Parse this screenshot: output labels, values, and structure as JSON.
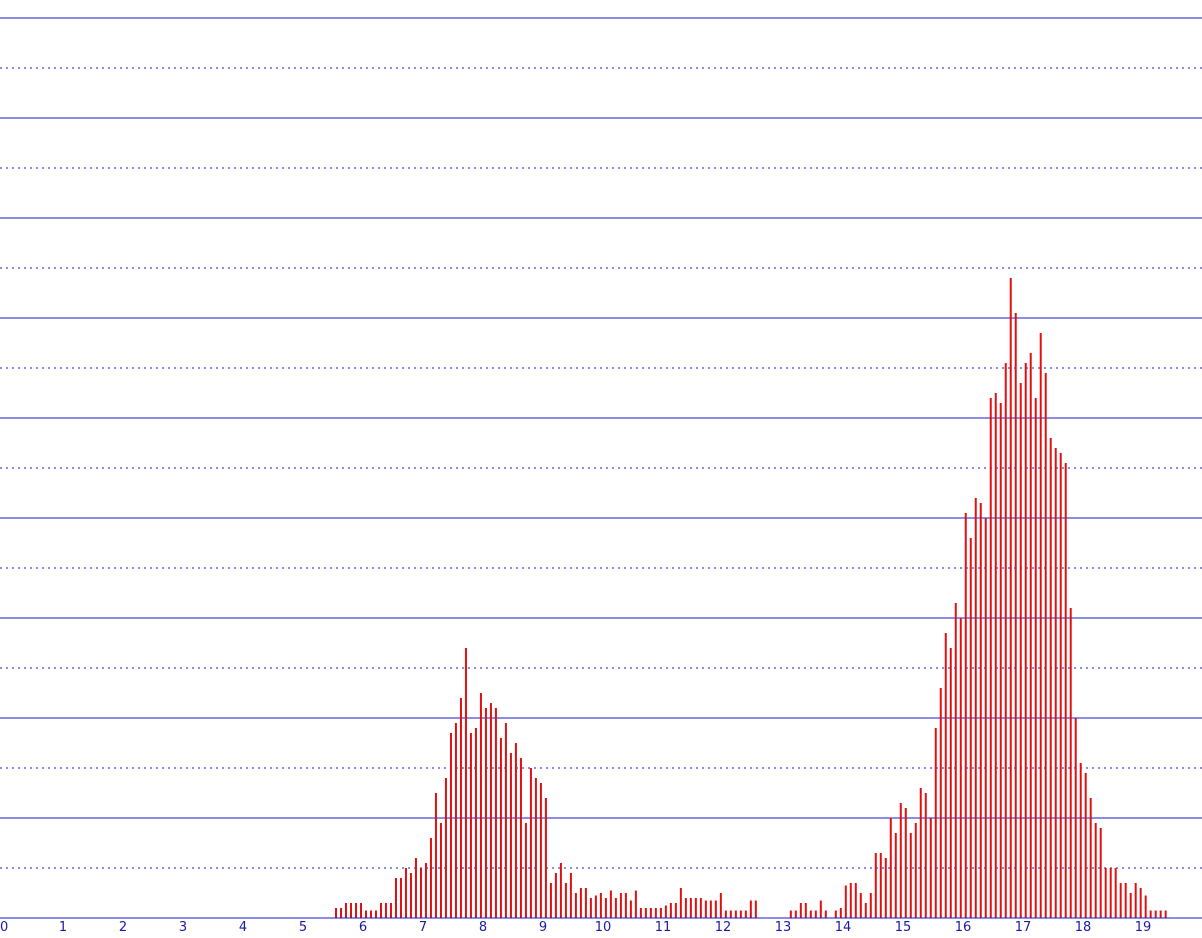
{
  "colors": {
    "background": "#ffffff",
    "grid": "#1a1acc",
    "bars": "#e01010",
    "tick_labels": "#1a1aa6"
  },
  "chart_data": {
    "type": "bar",
    "title": "",
    "xlabel": "",
    "ylabel": "",
    "grid": true,
    "legend": "none",
    "xlim": [
      0,
      19.6
    ],
    "ylim": [
      0,
      18.3
    ],
    "x_ticks": [
      "0",
      "1",
      "2",
      "3",
      "4",
      "5",
      "6",
      "7",
      "8",
      "9",
      "10",
      "11",
      "12",
      "13",
      "14",
      "15",
      "16",
      "17",
      "18",
      "19"
    ],
    "y_major_step": 2,
    "y_minor_step": 1,
    "bin_start": 5.55,
    "bin_width": 0.0833,
    "values": [
      0.2,
      0.2,
      0.3,
      0.3,
      0.3,
      0.3,
      0.15,
      0.15,
      0.15,
      0.3,
      0.3,
      0.3,
      0.8,
      0.8,
      1.0,
      0.9,
      1.2,
      1.0,
      1.1,
      1.6,
      2.5,
      1.9,
      2.8,
      3.7,
      3.9,
      4.4,
      5.4,
      3.7,
      3.8,
      4.5,
      4.2,
      4.3,
      4.2,
      3.6,
      3.9,
      3.3,
      3.5,
      3.2,
      1.9,
      3.0,
      2.8,
      2.7,
      2.4,
      0.7,
      0.9,
      1.1,
      0.7,
      0.9,
      0.5,
      0.6,
      0.6,
      0.4,
      0.45,
      0.5,
      0.4,
      0.55,
      0.4,
      0.5,
      0.5,
      0.35,
      0.55,
      0.2,
      0.2,
      0.2,
      0.2,
      0.2,
      0.25,
      0.3,
      0.3,
      0.6,
      0.4,
      0.4,
      0.4,
      0.4,
      0.35,
      0.35,
      0.35,
      0.5,
      0.15,
      0.15,
      0.15,
      0.15,
      0.15,
      0.35,
      0.35,
      0,
      0,
      0,
      0,
      0,
      0,
      0.15,
      0.15,
      0.3,
      0.3,
      0.15,
      0.15,
      0.35,
      0.15,
      0,
      0.15,
      0.2,
      0.65,
      0.7,
      0.7,
      0.5,
      0.3,
      0.5,
      1.3,
      1.3,
      1.2,
      2.0,
      1.7,
      2.3,
      2.2,
      1.7,
      1.9,
      2.6,
      2.5,
      2.0,
      3.8,
      4.6,
      5.7,
      5.4,
      6.3,
      6.0,
      8.1,
      7.6,
      8.4,
      8.3,
      8.0,
      10.4,
      10.5,
      10.3,
      11.1,
      12.8,
      12.1,
      10.7,
      11.1,
      11.3,
      10.4,
      11.7,
      10.9,
      9.6,
      9.4,
      9.3,
      9.1,
      6.2,
      4.0,
      3.1,
      2.9,
      2.4,
      1.9,
      1.8,
      1.0,
      1.0,
      1.0,
      0.7,
      0.7,
      0.5,
      0.7,
      0.6,
      0.45,
      0.15,
      0.15,
      0.15,
      0.15
    ]
  }
}
